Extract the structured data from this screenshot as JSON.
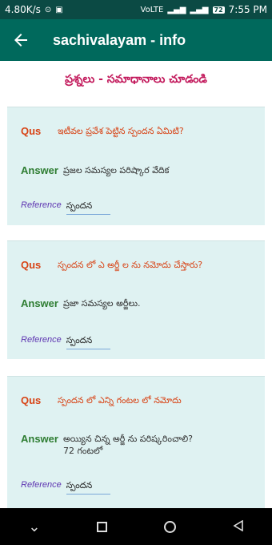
{
  "status": {
    "speed": "4.80K/s",
    "network": "VoLTE",
    "battery": "72",
    "time": "7:55 PM"
  },
  "header": {
    "title": "sachivalayam - info"
  },
  "section": {
    "heading": "ప్రశ్నలు - సమాధానాలు చూడండి"
  },
  "cards": [
    {
      "qus_label": "Qus",
      "question": "ఇటీవల ప్రవేశ పెట్టిన స్పందన ఏమిటి?",
      "answer_label": "Answer",
      "answer": "ప్రజల సమస్యల పరిష్కార వేదిక",
      "reference_label": "Reference",
      "reference": "స్పందన"
    },
    {
      "qus_label": "Qus",
      "question": "స్పందన లో ఎ అర్జీ ల ను నమోదు చేస్తారు?",
      "answer_label": "Answer",
      "answer": "ప్రజా సమస్యల అర్జీలు.",
      "reference_label": "Reference",
      "reference": "స్పందన"
    },
    {
      "qus_label": "Qus",
      "question": "స్పందన లో ఎన్ని గంటల లో నమోదు",
      "answer_label": "Answer",
      "answer": "అయ్యిన చిన్న అర్జీ ను పరిష్కరించాలి?",
      "answer_line2": "72 గంటలో",
      "reference_label": "Reference",
      "reference": "స్పందన"
    }
  ]
}
